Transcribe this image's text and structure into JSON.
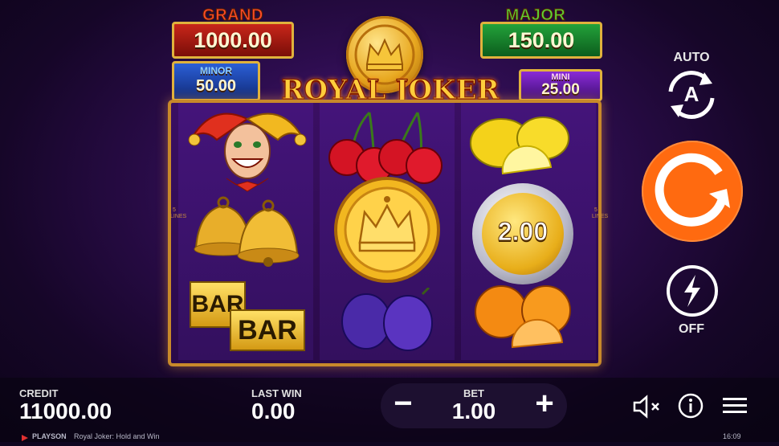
{
  "jackpots": {
    "grand": {
      "title": "GRAND",
      "value": "1000.00"
    },
    "major": {
      "title": "MAJOR",
      "value": "150.00"
    },
    "minor": {
      "title": "MINOR",
      "value": "50.00"
    },
    "mini": {
      "title": "MINI",
      "value": "25.00"
    }
  },
  "game": {
    "logo": "ROYAL JOKER",
    "lines_label": "5 LINES",
    "coin_value": "2.00",
    "bar_label": "BAR",
    "reels": [
      [
        "joker",
        "bells",
        "bar"
      ],
      [
        "cherries",
        "crown-coin",
        "plums"
      ],
      [
        "lemons",
        "silver-coin",
        "oranges"
      ]
    ]
  },
  "controls": {
    "auto_label": "AUTO",
    "auto_letter": "A",
    "turbo_label": "OFF"
  },
  "bottom": {
    "credit_label": "CREDIT",
    "credit_value": "11000.00",
    "last_win_label": "LAST WIN",
    "last_win_value": "0.00",
    "bet_label": "BET",
    "bet_value": "1.00",
    "minus": "−",
    "plus": "+"
  },
  "footer": {
    "brand": "PLAYSON",
    "game_title": "Royal Joker: Hold and Win",
    "time": "16:09"
  },
  "colors": {
    "spin": "#ff6a10",
    "grand": "#c8261a",
    "major": "#23a23a",
    "minor": "#2b5fd6",
    "mini": "#8a2bd6",
    "gold": "#e0b23c"
  }
}
